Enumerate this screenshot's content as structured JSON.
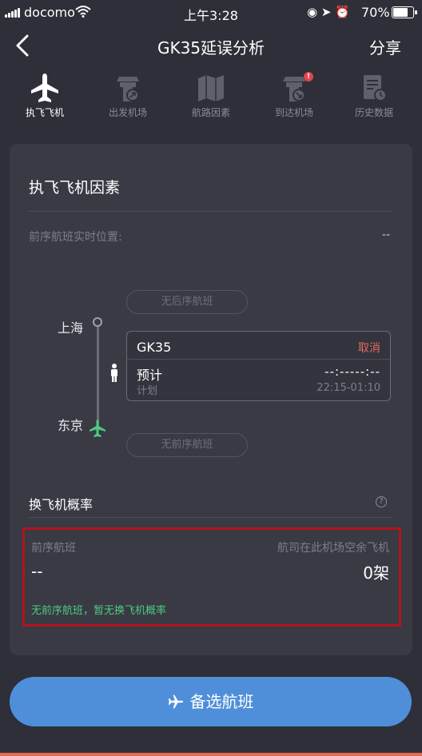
{
  "status_bar": {
    "carrier": "docomo",
    "time": "上午3:28",
    "battery_pct": "70%",
    "battery_level": 0.7
  },
  "nav": {
    "title": "GK35延误分析",
    "share_label": "分享"
  },
  "tabs": [
    {
      "label": "执飞飞机",
      "icon": "airplane-icon",
      "active": true
    },
    {
      "label": "出发机场",
      "icon": "departure-tower-icon",
      "active": false
    },
    {
      "label": "航路因素",
      "icon": "route-map-icon",
      "active": false
    },
    {
      "label": "到达机场",
      "icon": "arrival-tower-icon",
      "active": false,
      "alert": "!"
    },
    {
      "label": "历史数据",
      "icon": "history-clock-icon",
      "active": false
    }
  ],
  "card": {
    "title": "执飞飞机因素",
    "realtime_label": "前序航班实时位置:",
    "realtime_value": "--",
    "next_flight_pill": "无后序航班",
    "prev_flight_pill": "无前序航班",
    "route": {
      "origin": "上海",
      "destination": "东京"
    },
    "flight": {
      "number": "GK35",
      "status": "取消",
      "estimate_label": "预计",
      "estimate_value": "--:-----:--",
      "plan_label": "计划",
      "plan_value": "22:15-01:10"
    },
    "probability": {
      "title": "换飞机概率",
      "prev_flight_label": "前序航班",
      "spare_label": "航司在此机场空余飞机",
      "prev_flight_value": "--",
      "spare_value": "0架",
      "note": "无前序航班，暂无换飞机概率"
    }
  },
  "alt_button_label": "备选航班",
  "colors": {
    "background": "#2e2f38",
    "card": "#393a44",
    "accent_blue": "#4f8fd9",
    "cancel_red": "#e36a5f",
    "note_green": "#4fcb7d",
    "highlight_border": "#b0141c"
  }
}
